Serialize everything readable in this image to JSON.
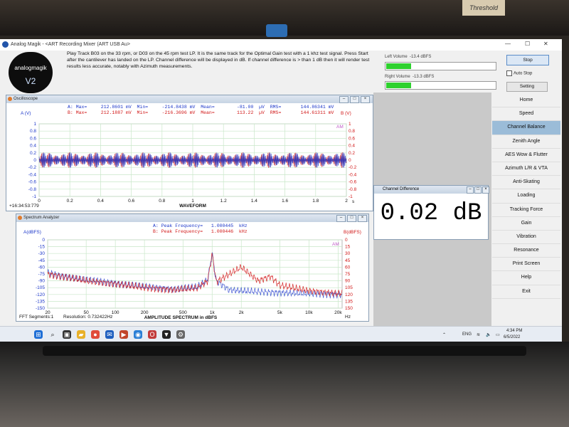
{
  "app": {
    "title": "Analog Magik - <ART Recording Mixer (ART USB Au>",
    "logo_text": "analogmagik",
    "logo_version": "V2"
  },
  "instructions": "Play Track B03 on the 33 rpm, or D03 on the 45 rpm test LP.  It is the same track for the Optimal Gain test with a 1 khz test signal. Press Start after the cantilever has landed on the LP.  Channel difference will be displayed in dB.  If channel difference is > than 1 dB then it will render test results less accurate, notably with Azimuth measurements.",
  "levels": {
    "left_label": "Left Volume",
    "left_value": "-13.4 dBFS",
    "left_fill": 0.23,
    "right_label": "Right Volume",
    "right_value": "-13.3 dBFS",
    "right_fill": 0.23
  },
  "controls": {
    "stop_label": "Stop",
    "autostop_label": "Auto Stop",
    "setting_label": "Setting"
  },
  "menu": {
    "items": [
      "Home",
      "Speed",
      "Channel Balance",
      "Zenith Angle",
      "AES Wow & Flutter",
      "Azimuth L/R & VTA",
      "Anti-Skating",
      "Loading",
      "Tracking Force",
      "Gain",
      "Vibration",
      "Resonance",
      "Print Screen",
      "Help",
      "Exit"
    ],
    "active": "Channel Balance"
  },
  "oscilloscope": {
    "title": "Oscilloscope",
    "stats_a": "A: Max=     212.8601 mV  Min=     -214.8438 mV  Mean=        -81.00  µV  RMS=       144.86341 mV",
    "stats_b": "B: Max=     212.1887 mV  Min=     -216.3696 mV  Mean=        113.22  µV  RMS=       144.61311 mV",
    "left_axis": "A (V)",
    "right_axis": "B (V)",
    "am_label": "AM",
    "xlabel": "WAVEFORM",
    "x_unit": "s",
    "timestamp": "+16:34:53:779"
  },
  "spectrum": {
    "title": "Spectrum Analyzer",
    "left_axis": "A(dBFS)",
    "right_axis": "B(dBFS)",
    "peak_a": "A: Peak Frequency=   1.000445  kHz",
    "peak_b": "B: Peak Frequency=   1.000446  kHz",
    "am_label": "AM",
    "xlabel": "AMPLITUDE SPECTRUM in dBFS",
    "x_unit": "Hz",
    "fft_segments": "FFT Segments:1",
    "resolution": "Resolution: 0.732422Hz"
  },
  "channel_difference": {
    "title": "Channel Difference",
    "value": "0.02 dB"
  },
  "taskbar": {
    "lang": "ENG",
    "time": "4:34 PM",
    "date": "6/5/2022"
  },
  "background": {
    "box_label": "Threshold"
  },
  "chart_data": [
    {
      "type": "line",
      "title": "",
      "xlabel": "WAVEFORM",
      "ylabel": "A (V)",
      "y2label": "B (V)",
      "x_ticks": [
        "0",
        "0.2",
        "0.4",
        "0.6",
        "0.8",
        "1",
        "1.2",
        "1.4",
        "1.6",
        "1.8",
        "2"
      ],
      "xlim": [
        0,
        2
      ],
      "y_ticks": [
        "1",
        "0.8",
        "0.6",
        "0.4",
        "0.2",
        "0",
        "-0.2",
        "-0.4",
        "-0.6",
        "-0.8",
        "-1"
      ],
      "ylim": [
        -1,
        1
      ],
      "grid": true,
      "series": [
        {
          "name": "A",
          "color": "#1b36c9",
          "amplitude": 0.2129
        },
        {
          "name": "B",
          "color": "#d11717",
          "amplitude": 0.2164
        }
      ]
    },
    {
      "type": "line",
      "title": "",
      "xlabel": "AMPLITUDE SPECTRUM in dBFS",
      "ylabel": "A(dBFS)",
      "y2label": "B(dBFS)",
      "x_ticks": [
        "20",
        "50",
        "100",
        "200",
        "500",
        "1k",
        "2k",
        "5k",
        "10k",
        "20k"
      ],
      "x_scale": "log",
      "xlim": [
        20,
        22000
      ],
      "left_y_ticks": [
        "0",
        "-15",
        "-30",
        "-45",
        "-60",
        "-75",
        "-90",
        "-105",
        "-120",
        "-135",
        "-150"
      ],
      "right_y_ticks": [
        "0",
        "15",
        "30",
        "45",
        "60",
        "75",
        "90",
        "105",
        "120",
        "135",
        "150"
      ],
      "ylim": [
        -150,
        0
      ],
      "grid": true,
      "peak_frequency_khz": [
        1.000445,
        1.000446
      ],
      "series": [
        {
          "name": "A",
          "color": "#1b36c9",
          "points": [
            [
              20,
              -72
            ],
            [
              30,
              -80
            ],
            [
              50,
              -88
            ],
            [
              100,
              -95
            ],
            [
              200,
              -103
            ],
            [
              400,
              -108
            ],
            [
              700,
              -104
            ],
            [
              900,
              -88
            ],
            [
              1000,
              -30
            ],
            [
              1100,
              -90
            ],
            [
              1500,
              -110
            ],
            [
              2000,
              -112
            ],
            [
              3000,
              -114
            ],
            [
              5000,
              -116
            ],
            [
              10000,
              -118
            ],
            [
              20000,
              -120
            ]
          ]
        },
        {
          "name": "B",
          "color": "#d11717",
          "points": [
            [
              20,
              -75
            ],
            [
              30,
              -82
            ],
            [
              50,
              -90
            ],
            [
              100,
              -97
            ],
            [
              200,
              -105
            ],
            [
              400,
              -110
            ],
            [
              700,
              -106
            ],
            [
              900,
              -90
            ],
            [
              1000,
              -30
            ],
            [
              1100,
              -92
            ],
            [
              2000,
              -60
            ],
            [
              3000,
              -90
            ],
            [
              4000,
              -80
            ],
            [
              5000,
              -100
            ],
            [
              10000,
              -112
            ],
            [
              20000,
              -118
            ]
          ]
        }
      ]
    }
  ]
}
